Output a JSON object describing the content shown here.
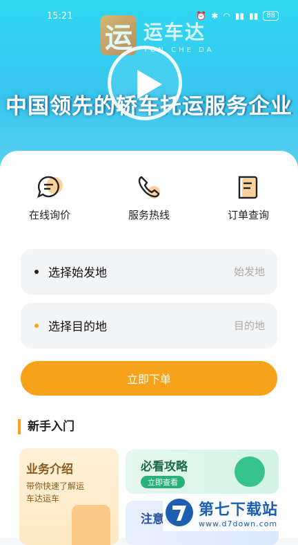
{
  "status": {
    "time": "15:21",
    "battery": "88"
  },
  "brand": {
    "name_cn": "运车达",
    "name_en": "YUN CHE DA",
    "logo_char": "运"
  },
  "hero": {
    "headline": "中国领先的轿车托运服务企业"
  },
  "quick_actions": [
    {
      "label": "在线询价",
      "icon": "chat-icon"
    },
    {
      "label": "服务热线",
      "icon": "phone-icon"
    },
    {
      "label": "订单查询",
      "icon": "document-icon"
    }
  ],
  "form": {
    "origin": {
      "label": "选择始发地",
      "placeholder": "始发地",
      "dot_color": "#222222"
    },
    "destination": {
      "label": "选择目的地",
      "placeholder": "目的地",
      "dot_color": "#f7a21b"
    },
    "submit_label": "立即下单"
  },
  "section": {
    "title": "新手入门"
  },
  "tiles": {
    "business": {
      "title": "业务介绍",
      "subtitle": "带你快速了解运车达运车"
    },
    "guide": {
      "title": "必看攻略",
      "button": "立即查看"
    },
    "notice": {
      "title": "注意事项"
    }
  },
  "watermark": {
    "cn": "第七下载站",
    "url": "www.d7down.com"
  },
  "colors": {
    "accent": "#f7a21b",
    "hero_start": "#2fd7f0",
    "hero_end": "#5ad2f2"
  }
}
